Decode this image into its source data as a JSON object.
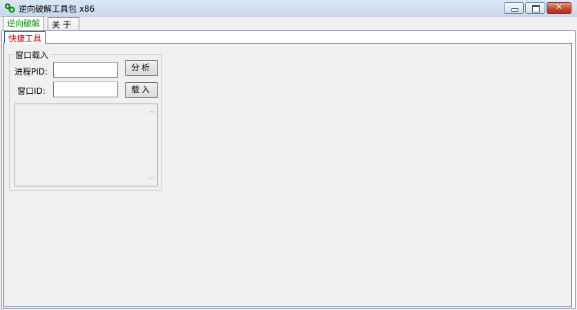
{
  "window": {
    "title": "逆向破解工具包 x86",
    "icon": "green-gear-icon"
  },
  "outer_tabs": [
    {
      "label": "逆向破解",
      "active": true
    },
    {
      "label": "关于",
      "active": false
    }
  ],
  "inner_tab": {
    "label": "快捷工具"
  },
  "group": {
    "legend": "窗口载入",
    "pid_label": "进程PID:",
    "pid_value": "",
    "wid_label": "窗口ID:",
    "wid_value": "",
    "analyze_button": "分析",
    "load_button": "载入"
  },
  "colors": {
    "active_tab_text": "#0b8a0b",
    "inner_tab_text": "#c00000",
    "inner_border": "#2c4fb0",
    "close_button": "#c74a31"
  }
}
